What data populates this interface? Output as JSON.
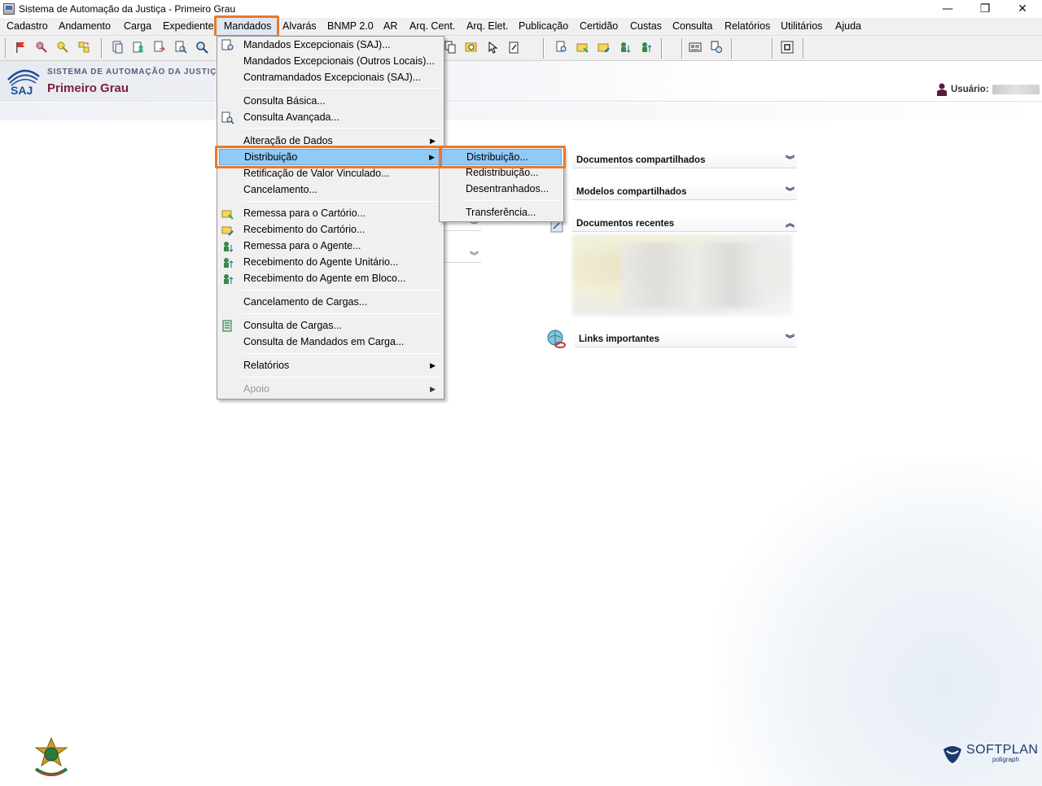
{
  "window": {
    "title": "Sistema de Automação da Justiça - Primeiro Grau",
    "minimize": "—",
    "maximize": "❐",
    "close": "✕"
  },
  "menubar": [
    "Cadastro",
    "Andamento",
    "Carga",
    "Expediente",
    "Mandados",
    "Alvarás",
    "BNMP 2.0",
    "AR",
    "Arq. Cent.",
    "Arq. Elet.",
    "Publicação",
    "Certidão",
    "Custas",
    "Consulta",
    "Relatórios",
    "Utilitários",
    "Ajuda"
  ],
  "active_menu": "Mandados",
  "header": {
    "brand_line": "SISTEMA DE AUTOMAÇÃO DA JUSTIÇA",
    "logo_text": "SAJ",
    "subtitle": "Primeiro Grau",
    "user_label": "Usuário:"
  },
  "panels": {
    "documentos_compartilhados": "Documentos compartilhados",
    "modelos_compartilhados": "Modelos compartilhados",
    "documentos_recentes": "Documentos recentes",
    "links_importantes": "Links importantes"
  },
  "mandados_menu": {
    "items": [
      {
        "label": "Mandados Excepcionais (SAJ)...",
        "icon": "mandado-icon"
      },
      {
        "label": "Mandados Excepcionais (Outros Locais)..."
      },
      {
        "label": "Contramandados Excepcionais (SAJ)..."
      },
      {
        "label": "Consulta Básica..."
      },
      {
        "label": "Consulta Avançada...",
        "icon": "search-doc-icon"
      },
      {
        "label": "Alteração de Dados",
        "submenu": true
      },
      {
        "label": "Distribuição",
        "submenu": true,
        "highlighted": true
      },
      {
        "label": "Retificação de Valor Vinculado..."
      },
      {
        "label": "Cancelamento..."
      },
      {
        "label": "Remessa para o Cartório...",
        "icon": "remessa-cartorio-icon"
      },
      {
        "label": "Recebimento do Cartório...",
        "icon": "recebimento-cartorio-icon"
      },
      {
        "label": "Remessa para o Agente...",
        "icon": "remessa-agente-icon"
      },
      {
        "label": "Recebimento do Agente Unitário...",
        "icon": "recebimento-agente-icon"
      },
      {
        "label": "Recebimento do Agente em Bloco...",
        "icon": "recebimento-bloco-icon"
      },
      {
        "label": "Cancelamento de Cargas..."
      },
      {
        "label": "Consulta de Cargas...",
        "icon": "consulta-cargas-icon"
      },
      {
        "label": "Consulta de Mandados em Carga..."
      },
      {
        "label": "Relatórios",
        "submenu": true
      },
      {
        "label": "Apoio",
        "submenu": true,
        "disabled": true
      }
    ]
  },
  "distribuicao_submenu": {
    "items": [
      {
        "label": "Distribuição...",
        "highlighted": true
      },
      {
        "label": "Redistribuição..."
      },
      {
        "label": "Desentranhados..."
      },
      {
        "label": "Transferência..."
      }
    ]
  },
  "footer": {
    "softplan": "SOFTPLAN",
    "softplan_sub": "poligraph"
  },
  "colors": {
    "highlight_box": "#e8792a",
    "menu_selection": "#91c9f7",
    "brand_maroon": "#7a1f3d",
    "brand_blue": "#1a4f9a"
  }
}
